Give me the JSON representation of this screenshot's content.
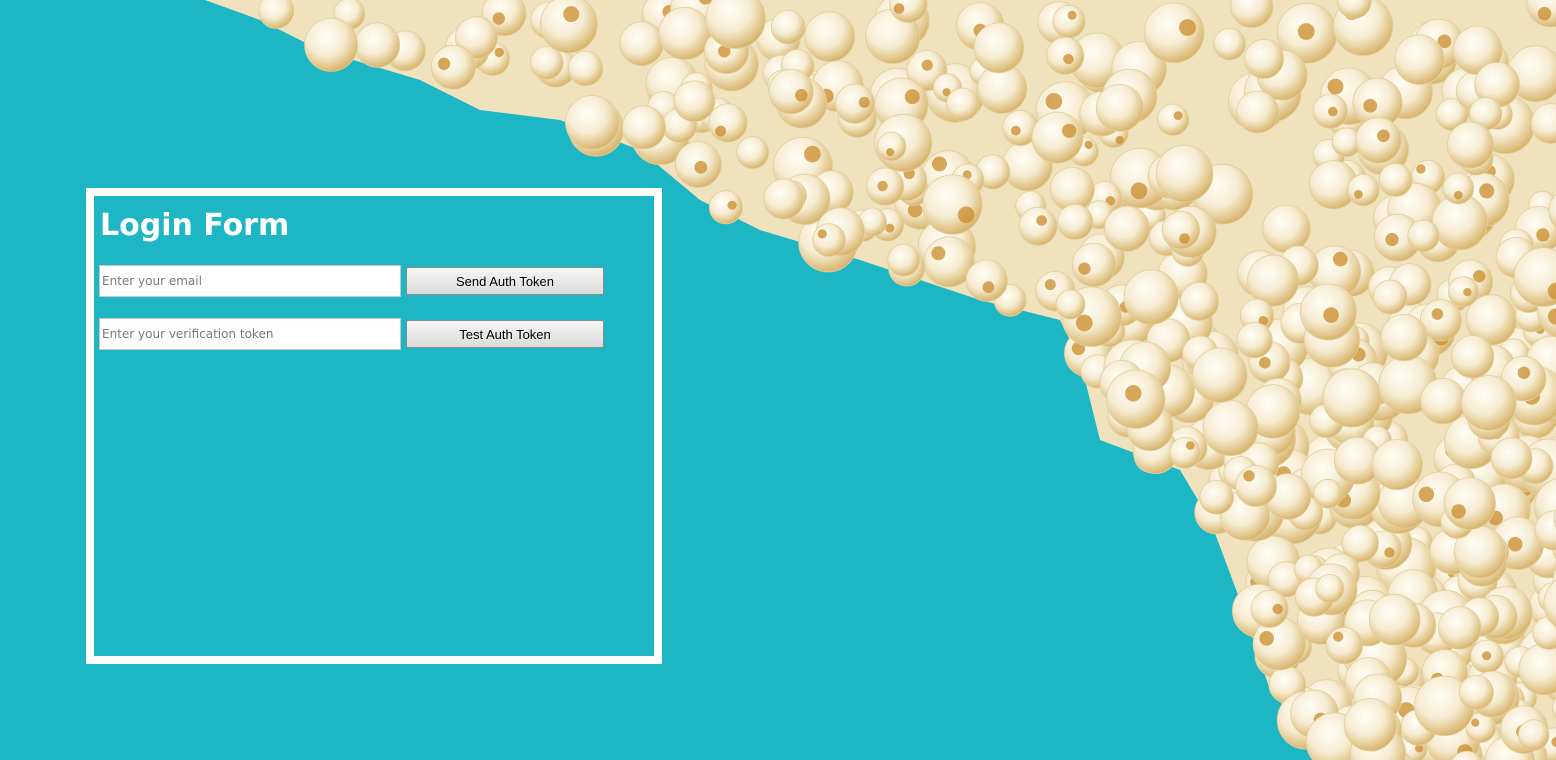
{
  "page": {
    "background_color": "#1db6c4",
    "decoration": "popcorn-pile"
  },
  "login_form": {
    "title": "Login Form",
    "email": {
      "value": "",
      "placeholder": "Enter your email"
    },
    "send_button_label": "Send Auth Token",
    "token": {
      "value": "",
      "placeholder": "Enter your verification token"
    },
    "test_button_label": "Test Auth Token"
  }
}
